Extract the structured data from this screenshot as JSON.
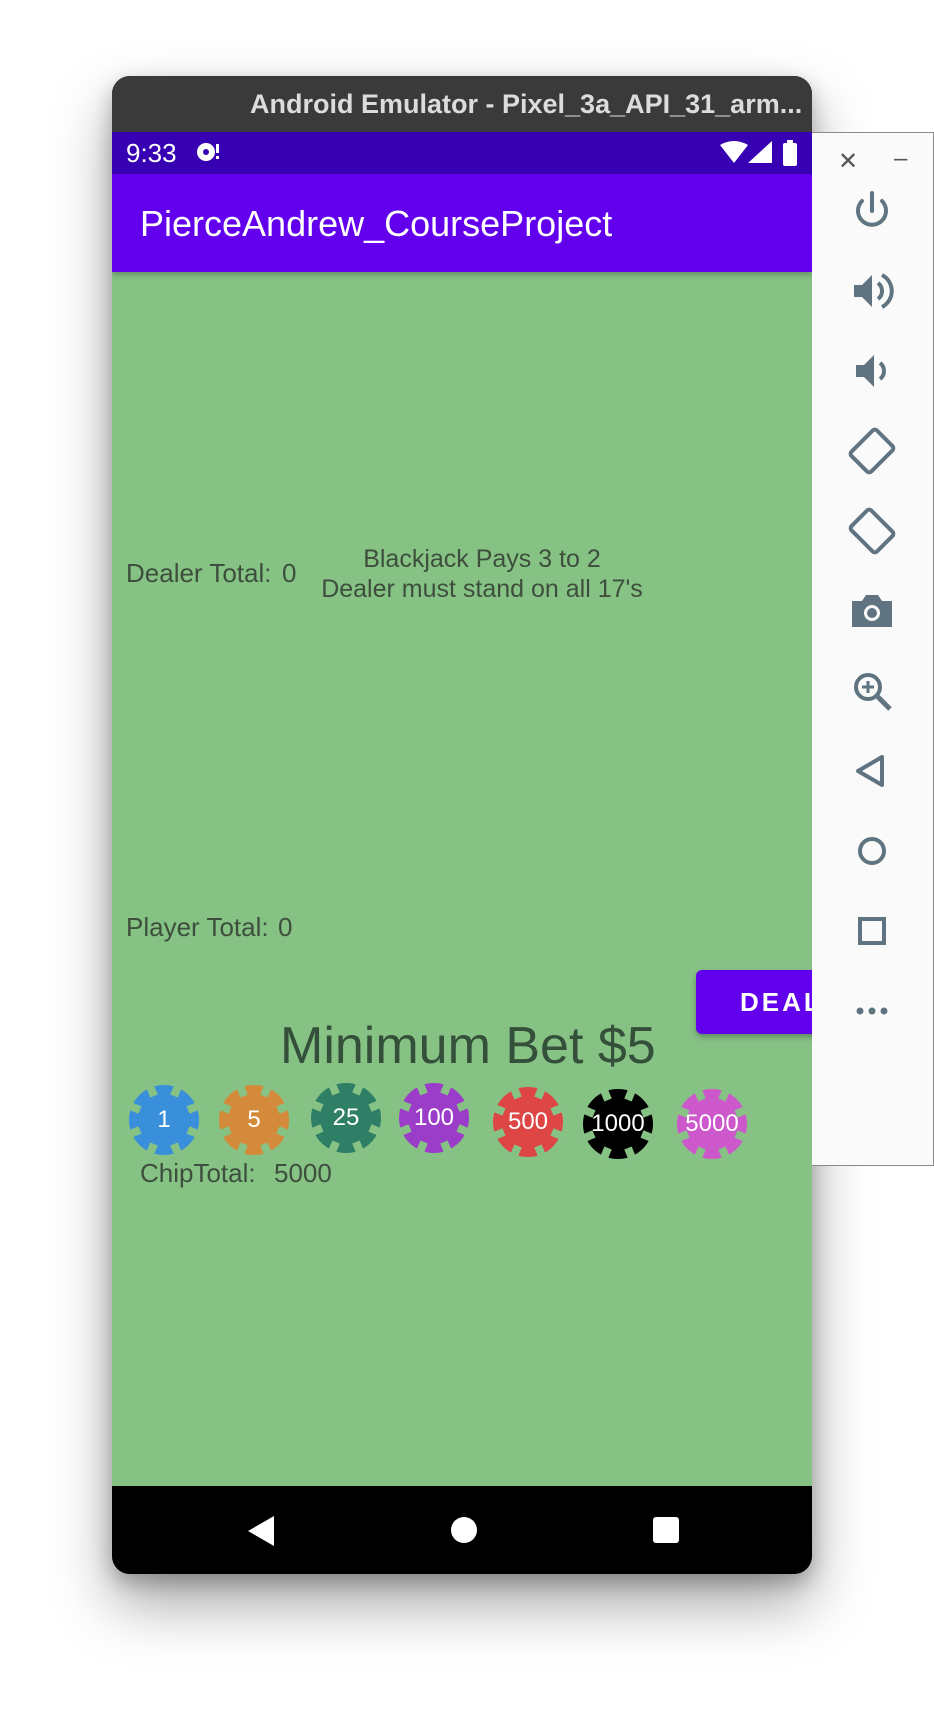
{
  "window": {
    "title": "Android Emulator - Pixel_3a_API_31_arm..."
  },
  "status_bar": {
    "time": "9:33"
  },
  "app_bar": {
    "title": "PierceAndrew_CourseProject"
  },
  "game": {
    "dealer_label": "Dealer Total:",
    "dealer_total": "0",
    "rules_line1": "Blackjack Pays 3 to 2",
    "rules_line2": "Dealer must stand on all 17's",
    "player_label": "Player Total:",
    "player_total": "0",
    "deal_button": "DEAL",
    "min_bet": "Minimum Bet $5",
    "chip_total_label": "ChipTotal:",
    "chip_total": "5000"
  },
  "chips": [
    {
      "label": "1",
      "color": "#3a8fdb"
    },
    {
      "label": "5",
      "color": "#d38a3a"
    },
    {
      "label": "25",
      "color": "#2f7f66"
    },
    {
      "label": "100",
      "color": "#9b3dc8"
    },
    {
      "label": "500",
      "color": "#de4545"
    },
    {
      "label": "1000",
      "color": "#000000"
    },
    {
      "label": "5000",
      "color": "#cc58cc"
    }
  ],
  "side_panel": {
    "buttons": [
      "power-icon",
      "volume-up-icon",
      "volume-down-icon",
      "rotate-left-icon",
      "rotate-right-icon",
      "camera-icon",
      "zoom-icon",
      "back-icon",
      "home-icon",
      "overview-icon",
      "more-icon"
    ]
  },
  "colors": {
    "status_bar": "#3700b3",
    "app_bar": "#6200ee",
    "felt": "#87c285"
  }
}
